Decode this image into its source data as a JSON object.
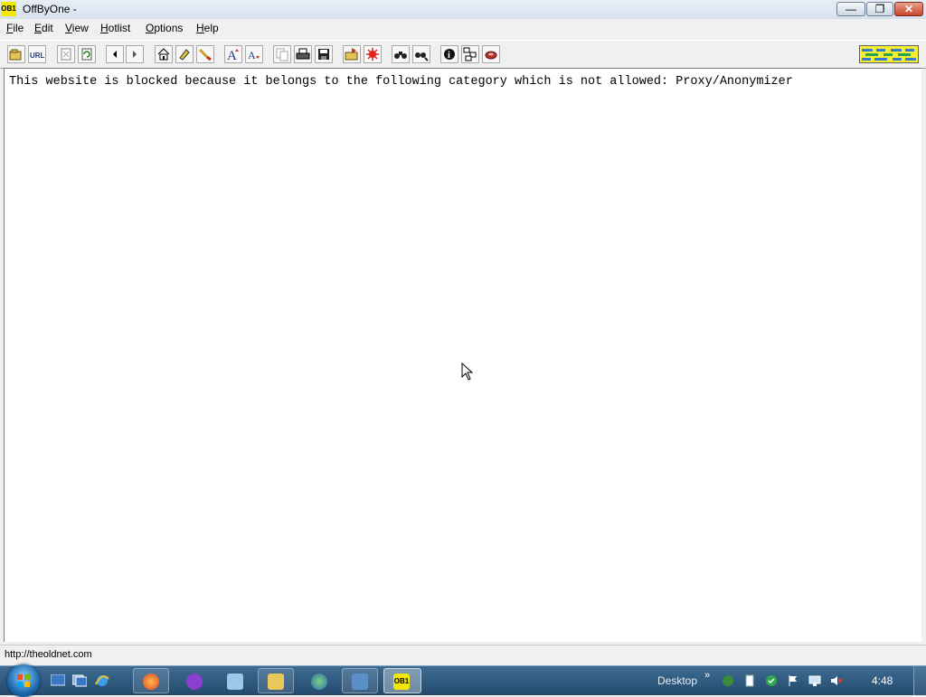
{
  "window": {
    "app_icon_text": "OB1",
    "title": "OffByOne -"
  },
  "menu": {
    "items": [
      {
        "name": "file",
        "label": "File"
      },
      {
        "name": "edit",
        "label": "Edit"
      },
      {
        "name": "view",
        "label": "View"
      },
      {
        "name": "hotlist",
        "label": "Hotlist"
      },
      {
        "name": "options",
        "label": "Options"
      },
      {
        "name": "help",
        "label": "Help"
      }
    ]
  },
  "toolbar": {
    "icons": [
      "open-file-icon",
      "open-url-icon",
      "stop-icon",
      "reload-icon",
      "back-icon",
      "forward-icon",
      "home-icon",
      "bookmark-icon",
      "clear-icon",
      "font-larger-icon",
      "font-smaller-icon",
      "copy-icon",
      "print-icon",
      "save-icon",
      "open-folder-icon",
      "settings-icon",
      "find-icon",
      "find-next-icon",
      "info-icon",
      "source-icon",
      "cookie-icon"
    ]
  },
  "page": {
    "message": "This website is blocked because it belongs to the following category which is not allowed: Proxy/Anonymizer"
  },
  "status": {
    "url": "http://theoldnet.com"
  },
  "taskbar": {
    "desktop_label": "Desktop",
    "expand_glyph": "»",
    "clock": "4:48",
    "active_app_label": "OB1"
  }
}
